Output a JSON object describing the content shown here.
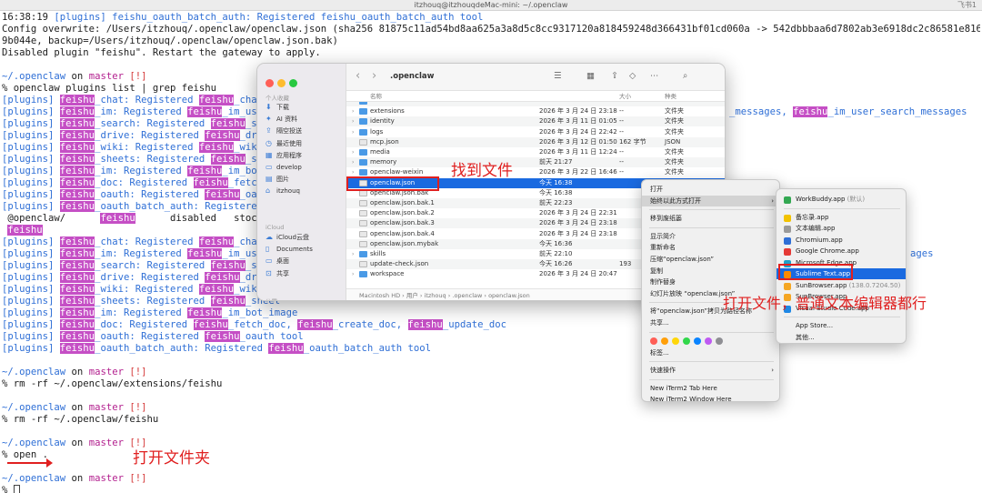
{
  "window": {
    "title": "itzhouq@itzhouqdeMac-mini: ~/.openclaw",
    "corner": "飞书1"
  },
  "terminal": {
    "lines": [
      [
        {
          "t": "16:38:19 ",
          "c": "c-k"
        },
        {
          "t": "[plugins] feishu_oauth_batch_auth: Registered feishu_oauth_batch_auth tool",
          "c": "c-b"
        }
      ],
      [
        {
          "t": "Config overwrite: /Users/itzhouq/.openclaw/openclaw.json (sha256 81875c11ad54bd8aa625a3a8d5c8cc9317120a818459248d366431bf01cd060a -> 542dbbbaa6d7802ab3e6918dc2c86581e81626d0a4a36d13ea5b78b537",
          "c": "c-k"
        }
      ],
      [
        {
          "t": "9b044e, backup=/Users/itzhouq/.openclaw/openclaw.json.bak)",
          "c": "c-k"
        }
      ],
      [
        {
          "t": "Disabled plugin \"feishu\". Restart the gateway to apply.",
          "c": "c-k"
        }
      ],
      [],
      [
        {
          "t": "~/.openclaw",
          "c": "c-b"
        },
        {
          "t": " on ",
          "c": "c-k"
        },
        {
          "t": "master",
          "c": "c-m"
        },
        {
          "t": " [!]",
          "c": "c-r"
        }
      ],
      [
        {
          "t": "% openclaw plugins list | grep feishu",
          "c": "c-k"
        }
      ],
      [
        {
          "t": "[plugins] ",
          "c": "c-b"
        },
        {
          "t": "feishu",
          "c": "hl"
        },
        {
          "t": "_chat: Registered ",
          "c": "c-b"
        },
        {
          "t": "feishu",
          "c": "hl"
        },
        {
          "t": "_chat, ",
          "c": "c-b"
        },
        {
          "t": "fe",
          "c": "hl"
        }
      ],
      [
        {
          "t": "[plugins] ",
          "c": "c-b"
        },
        {
          "t": "feishu",
          "c": "hl"
        },
        {
          "t": "_im: Registered ",
          "c": "c-b"
        },
        {
          "t": "feishu",
          "c": "hl"
        },
        {
          "t": "_im_user_mes",
          "c": "c-b"
        }
      ],
      [
        {
          "t": "[plugins] ",
          "c": "c-b"
        },
        {
          "t": "feishu",
          "c": "hl"
        },
        {
          "t": "_search: Registered ",
          "c": "c-b"
        },
        {
          "t": "feishu",
          "c": "hl"
        },
        {
          "t": "_search_",
          "c": "c-b"
        }
      ],
      [
        {
          "t": "[plugins] ",
          "c": "c-b"
        },
        {
          "t": "feishu",
          "c": "hl"
        },
        {
          "t": "_drive: Registered ",
          "c": "c-b"
        },
        {
          "t": "feishu",
          "c": "hl"
        },
        {
          "t": "_drive_fi",
          "c": "c-b"
        }
      ],
      [
        {
          "t": "[plugins] ",
          "c": "c-b"
        },
        {
          "t": "feishu",
          "c": "hl"
        },
        {
          "t": "_wiki: Registered ",
          "c": "c-b"
        },
        {
          "t": "feishu",
          "c": "hl"
        },
        {
          "t": "_wiki_spac",
          "c": "c-b"
        }
      ],
      [
        {
          "t": "[plugins] ",
          "c": "c-b"
        },
        {
          "t": "feishu",
          "c": "hl"
        },
        {
          "t": "_sheets: Registered ",
          "c": "c-b"
        },
        {
          "t": "feishu",
          "c": "hl"
        },
        {
          "t": "_sheet",
          "c": "c-b"
        }
      ],
      [
        {
          "t": "[plugins] ",
          "c": "c-b"
        },
        {
          "t": "feishu",
          "c": "hl"
        },
        {
          "t": "_im: Registered ",
          "c": "c-b"
        },
        {
          "t": "feishu",
          "c": "hl"
        },
        {
          "t": "_im_bot_imag",
          "c": "c-b"
        }
      ],
      [
        {
          "t": "[plugins] ",
          "c": "c-b"
        },
        {
          "t": "feishu",
          "c": "hl"
        },
        {
          "t": "_doc: Registered ",
          "c": "c-b"
        },
        {
          "t": "feishu",
          "c": "hl"
        },
        {
          "t": "_fetch_doc, ",
          "c": "c-b"
        }
      ],
      [
        {
          "t": "[plugins] ",
          "c": "c-b"
        },
        {
          "t": "feishu",
          "c": "hl"
        },
        {
          "t": "_oauth: Registered ",
          "c": "c-b"
        },
        {
          "t": "feishu",
          "c": "hl"
        },
        {
          "t": "_oauth to",
          "c": "c-b"
        }
      ],
      [
        {
          "t": "[plugins] ",
          "c": "c-b"
        },
        {
          "t": "feishu",
          "c": "hl"
        },
        {
          "t": "_oauth_batch_auth: Registered ",
          "c": "c-b"
        },
        {
          "t": "fe",
          "c": "hl"
        }
      ],
      [
        {
          "t": " @openclaw/      ",
          "c": "c-k"
        },
        {
          "t": "feishu",
          "c": "hl"
        },
        {
          "t": "      disabled   stock:",
          "c": "c-k"
        },
        {
          "t": "feis",
          "c": "hl"
        }
      ],
      [
        {
          "t": " ",
          "c": "c-k"
        },
        {
          "t": "feishu",
          "c": "hl"
        },
        {
          "t": "                                      OpenClaw Fe",
          "c": "c-k"
        }
      ],
      [
        {
          "t": "[plugins] ",
          "c": "c-b"
        },
        {
          "t": "feishu",
          "c": "hl"
        },
        {
          "t": "_chat: Registered ",
          "c": "c-b"
        },
        {
          "t": "feishu",
          "c": "hl"
        },
        {
          "t": "_chat, ",
          "c": "c-b"
        },
        {
          "t": "fe",
          "c": "hl"
        }
      ],
      [
        {
          "t": "[plugins] ",
          "c": "c-b"
        },
        {
          "t": "feishu",
          "c": "hl"
        },
        {
          "t": "_im: Registered ",
          "c": "c-b"
        },
        {
          "t": "feishu",
          "c": "hl"
        },
        {
          "t": "_im_user_mes",
          "c": "c-b"
        }
      ],
      [
        {
          "t": "[plugins] ",
          "c": "c-b"
        },
        {
          "t": "feishu",
          "c": "hl"
        },
        {
          "t": "_search: Registered ",
          "c": "c-b"
        },
        {
          "t": "feishu",
          "c": "hl"
        },
        {
          "t": "_search_",
          "c": "c-b"
        }
      ],
      [
        {
          "t": "[plugins] ",
          "c": "c-b"
        },
        {
          "t": "feishu",
          "c": "hl"
        },
        {
          "t": "_drive: Registered ",
          "c": "c-b"
        },
        {
          "t": "feishu",
          "c": "hl"
        },
        {
          "t": "_drive_fi",
          "c": "c-b"
        }
      ],
      [
        {
          "t": "[plugins] ",
          "c": "c-b"
        },
        {
          "t": "feishu",
          "c": "hl"
        },
        {
          "t": "_wiki: Registered ",
          "c": "c-b"
        },
        {
          "t": "feishu",
          "c": "hl"
        },
        {
          "t": "_wiki_spac",
          "c": "c-b"
        }
      ],
      [
        {
          "t": "[plugins] ",
          "c": "c-b"
        },
        {
          "t": "feishu",
          "c": "hl"
        },
        {
          "t": "_sheets: Registered ",
          "c": "c-b"
        },
        {
          "t": "feishu",
          "c": "hl"
        },
        {
          "t": "_sheet",
          "c": "c-b"
        }
      ],
      [
        {
          "t": "[plugins] ",
          "c": "c-b"
        },
        {
          "t": "feishu",
          "c": "hl"
        },
        {
          "t": "_im: Registered ",
          "c": "c-b"
        },
        {
          "t": "feishu",
          "c": "hl"
        },
        {
          "t": "_im_bot_image",
          "c": "c-b"
        }
      ],
      [
        {
          "t": "[plugins] ",
          "c": "c-b"
        },
        {
          "t": "feishu",
          "c": "hl"
        },
        {
          "t": "_doc: Registered ",
          "c": "c-b"
        },
        {
          "t": "feishu",
          "c": "hl"
        },
        {
          "t": "_fetch_doc, ",
          "c": "c-b"
        },
        {
          "t": "feishu",
          "c": "hl"
        },
        {
          "t": "_create_doc, ",
          "c": "c-b"
        },
        {
          "t": "feishu",
          "c": "hl"
        },
        {
          "t": "_update_doc",
          "c": "c-b"
        }
      ],
      [
        {
          "t": "[plugins] ",
          "c": "c-b"
        },
        {
          "t": "feishu",
          "c": "hl"
        },
        {
          "t": "_oauth: Registered ",
          "c": "c-b"
        },
        {
          "t": "feishu",
          "c": "hl"
        },
        {
          "t": "_oauth tool",
          "c": "c-b"
        }
      ],
      [
        {
          "t": "[plugins] ",
          "c": "c-b"
        },
        {
          "t": "feishu",
          "c": "hl"
        },
        {
          "t": "_oauth_batch_auth: Registered ",
          "c": "c-b"
        },
        {
          "t": "feishu",
          "c": "hl"
        },
        {
          "t": "_oauth_batch_auth tool",
          "c": "c-b"
        }
      ],
      [],
      [
        {
          "t": "~/.openclaw",
          "c": "c-b"
        },
        {
          "t": " on ",
          "c": "c-k"
        },
        {
          "t": "master",
          "c": "c-m"
        },
        {
          "t": " [!]",
          "c": "c-r"
        }
      ],
      [
        {
          "t": "% rm -rf ~/.openclaw/extensions/feishu",
          "c": "c-k"
        }
      ],
      [],
      [
        {
          "t": "~/.openclaw",
          "c": "c-b"
        },
        {
          "t": " on ",
          "c": "c-k"
        },
        {
          "t": "master",
          "c": "c-m"
        },
        {
          "t": " [!]",
          "c": "c-r"
        }
      ],
      [
        {
          "t": "% rm -rf ~/.openclaw/feishu",
          "c": "c-k"
        }
      ],
      [],
      [
        {
          "t": "~/.openclaw",
          "c": "c-b"
        },
        {
          "t": " on ",
          "c": "c-k"
        },
        {
          "t": "master",
          "c": "c-m"
        },
        {
          "t": " [!]",
          "c": "c-r"
        }
      ],
      [
        {
          "t": "% open .",
          "c": "c-k"
        }
      ],
      [],
      [
        {
          "t": "~/.openclaw",
          "c": "c-b"
        },
        {
          "t": " on ",
          "c": "c-k"
        },
        {
          "t": "master",
          "c": "c-m"
        },
        {
          "t": " [!]",
          "c": "c-r"
        }
      ],
      [
        {
          "t": "% ",
          "c": "c-k"
        },
        {
          "t": "",
          "c": "cursor"
        }
      ]
    ],
    "right_fragments": [
      {
        "row": 8,
        "spans": [
          {
            "t": "_messages, ",
            "c": "c-b"
          },
          {
            "t": "feishu",
            "c": "hl"
          },
          {
            "t": "_im_user_search_messages",
            "c": "c-b"
          }
        ]
      },
      {
        "row": 20,
        "spans": [
          {
            "t": "ages",
            "c": "c-b"
          }
        ]
      }
    ]
  },
  "annotations": {
    "open_folder": "打开文件夹",
    "find_file": "找到文件",
    "open_file": "打开文件，普通文本编辑器都行"
  },
  "finder": {
    "title": ".openclaw",
    "sidebar": {
      "favorites_head": "个人收藏",
      "favorites": [
        {
          "icon": "⬇",
          "label": "下载",
          "name": "downloads-icon"
        },
        {
          "icon": "✦",
          "label": "AI 资料",
          "name": "folder-icon"
        },
        {
          "icon": "⇪",
          "label": "隔空投送",
          "name": "airdrop-icon"
        },
        {
          "icon": "◷",
          "label": "最近使用",
          "name": "recents-icon"
        },
        {
          "icon": "▦",
          "label": "应用程序",
          "name": "applications-icon"
        },
        {
          "icon": "▭",
          "label": "develop",
          "name": "folder-icon"
        },
        {
          "icon": "▤",
          "label": "图片",
          "name": "pictures-icon"
        },
        {
          "icon": "⌂",
          "label": "itzhouq",
          "name": "home-icon"
        }
      ],
      "icloud_head": "iCloud",
      "icloud": [
        {
          "icon": "☁",
          "label": "iCloud云盘",
          "name": "icloud-icon"
        },
        {
          "icon": "▯",
          "label": "Documents",
          "name": "documents-icon"
        },
        {
          "icon": "▭",
          "label": "桌面",
          "name": "desktop-icon"
        },
        {
          "icon": "⊡",
          "label": "共享",
          "name": "shared-icon"
        }
      ],
      "locations_head": "位置"
    },
    "columns": {
      "name": "名称",
      "size": "大小",
      "kind": "种类"
    },
    "rows": [
      {
        "chev": "",
        "type": "folder",
        "name": "",
        "date": "",
        "size": "",
        "kind": ""
      },
      {
        "chev": "›",
        "type": "folder",
        "name": "extensions",
        "date": "2026 年 3 月 24 日 23:18",
        "size": "--",
        "kind": "文件夹"
      },
      {
        "chev": "›",
        "type": "folder",
        "name": "identity",
        "date": "2026 年 3 月 11 日 01:05",
        "size": "--",
        "kind": "文件夹"
      },
      {
        "chev": "›",
        "type": "folder",
        "name": "logs",
        "date": "2026 年 3 月 24 日 22:42",
        "size": "--",
        "kind": "文件夹"
      },
      {
        "chev": "",
        "type": "file",
        "name": "mcp.json",
        "date": "2026 年 3 月 12 日 01:50",
        "size": "162 字节",
        "kind": "JSON"
      },
      {
        "chev": "›",
        "type": "folder",
        "name": "media",
        "date": "2026 年 3 月 11 日 12:24",
        "size": "--",
        "kind": "文件夹"
      },
      {
        "chev": "›",
        "type": "folder",
        "name": "memory",
        "date": "前天 21:27",
        "size": "--",
        "kind": "文件夹"
      },
      {
        "chev": "›",
        "type": "folder",
        "name": "openclaw-weixin",
        "date": "2026 年 3 月 22 日 16:46",
        "size": "--",
        "kind": "文件夹"
      },
      {
        "chev": "",
        "type": "file",
        "name": "openclaw.json",
        "date": "今天 16:38",
        "size": "",
        "kind": "",
        "selected": true
      },
      {
        "chev": "",
        "type": "file",
        "name": "openclaw.json.bak",
        "date": "今天 16:38",
        "size": "",
        "kind": ""
      },
      {
        "chev": "",
        "type": "file",
        "name": "openclaw.json.bak.1",
        "date": "前天 22:23",
        "size": "",
        "kind": ""
      },
      {
        "chev": "",
        "type": "file",
        "name": "openclaw.json.bak.2",
        "date": "2026 年 3 月 24 日 22:31",
        "size": "",
        "kind": ""
      },
      {
        "chev": "",
        "type": "file",
        "name": "openclaw.json.bak.3",
        "date": "2026 年 3 月 24 日 23:18",
        "size": "",
        "kind": ""
      },
      {
        "chev": "",
        "type": "file",
        "name": "openclaw.json.bak.4",
        "date": "2026 年 3 月 24 日 23:18",
        "size": "",
        "kind": ""
      },
      {
        "chev": "",
        "type": "file",
        "name": "openclaw.json.mybak",
        "date": "今天 16:36",
        "size": "",
        "kind": ""
      },
      {
        "chev": "›",
        "type": "folder",
        "name": "skills",
        "date": "前天 22:10",
        "size": "",
        "kind": ""
      },
      {
        "chev": "",
        "type": "file",
        "name": "update-check.json",
        "date": "今天 16:26",
        "size": "193",
        "kind": ""
      },
      {
        "chev": "›",
        "type": "folder",
        "name": "workspace",
        "date": "2026 年 3 月 24 日 20:47",
        "size": "",
        "kind": ""
      }
    ],
    "path": "Macintosh HD  ›  用户  ›  itzhouq  ›  .openclaw  ›  openclaw.json"
  },
  "context_menu": {
    "items": [
      {
        "label": "打开",
        "kind": "item"
      },
      {
        "label": "始终以此方式打开",
        "kind": "item",
        "active": true,
        "arrow": "›"
      },
      {
        "kind": "sep"
      },
      {
        "label": "移到废纸篓",
        "kind": "item"
      },
      {
        "kind": "sep"
      },
      {
        "label": "显示简介",
        "kind": "item"
      },
      {
        "label": "重新命名",
        "kind": "item"
      },
      {
        "label": "压缩“openclaw.json”",
        "kind": "item"
      },
      {
        "label": "复制",
        "kind": "item"
      },
      {
        "label": "制作替身",
        "kind": "item"
      },
      {
        "label": "幻灯片放映 “openclaw.json”",
        "kind": "item"
      },
      {
        "kind": "sep"
      },
      {
        "label": "将“openclaw.json”拷贝为路径名称",
        "kind": "item"
      },
      {
        "label": "共享...",
        "kind": "item"
      },
      {
        "kind": "sep"
      },
      {
        "kind": "dots"
      },
      {
        "label": "标签...",
        "kind": "item"
      },
      {
        "kind": "sep"
      },
      {
        "label": "快速操作",
        "kind": "item",
        "arrow": "›"
      },
      {
        "kind": "sep"
      },
      {
        "label": "New iTerm2 Tab Here",
        "kind": "item"
      },
      {
        "label": "New iTerm2 Window Here",
        "kind": "item"
      }
    ],
    "tag_colors": [
      "#ff5f57",
      "#ff9f0a",
      "#ffd60a",
      "#32d74b",
      "#0a84ff",
      "#bf5af2",
      "#8e8e93"
    ]
  },
  "submenu": {
    "items": [
      {
        "label": "WorkBuddy.app",
        "aux": " (默认)",
        "color": "#33a852",
        "kind": "item"
      },
      {
        "kind": "sep"
      },
      {
        "label": "备忘录.app",
        "aux": "",
        "color": "#f2c200",
        "kind": "item"
      },
      {
        "label": "文本编辑.app",
        "aux": "",
        "color": "#9a9a9a",
        "kind": "item"
      },
      {
        "label": "Chromium.app",
        "aux": "",
        "color": "#2f6fd6",
        "kind": "item"
      },
      {
        "label": "Google Chrome.app",
        "aux": "",
        "color": "#e53935",
        "kind": "item"
      },
      {
        "label": "Microsoft Edge.app",
        "aux": "",
        "color": "#1fa0c8",
        "kind": "item"
      },
      {
        "label": "Sublime Text.app",
        "aux": "",
        "color": "#ff8a00",
        "kind": "item",
        "active": true
      },
      {
        "label": "SunBrowser.app",
        "aux": " (138.0.7204.50)",
        "color": "#f5a623",
        "kind": "item"
      },
      {
        "label": "SunBrowser.app",
        "aux": "",
        "color": "#f5a623",
        "kind": "item"
      },
      {
        "label": "Visual Studio Code.app",
        "aux": "",
        "color": "#1e88e5",
        "kind": "item"
      },
      {
        "kind": "sep"
      },
      {
        "label": "App Store...",
        "aux": "",
        "color": "",
        "kind": "item"
      },
      {
        "label": "其他...",
        "aux": "",
        "color": "",
        "kind": "item"
      }
    ]
  }
}
